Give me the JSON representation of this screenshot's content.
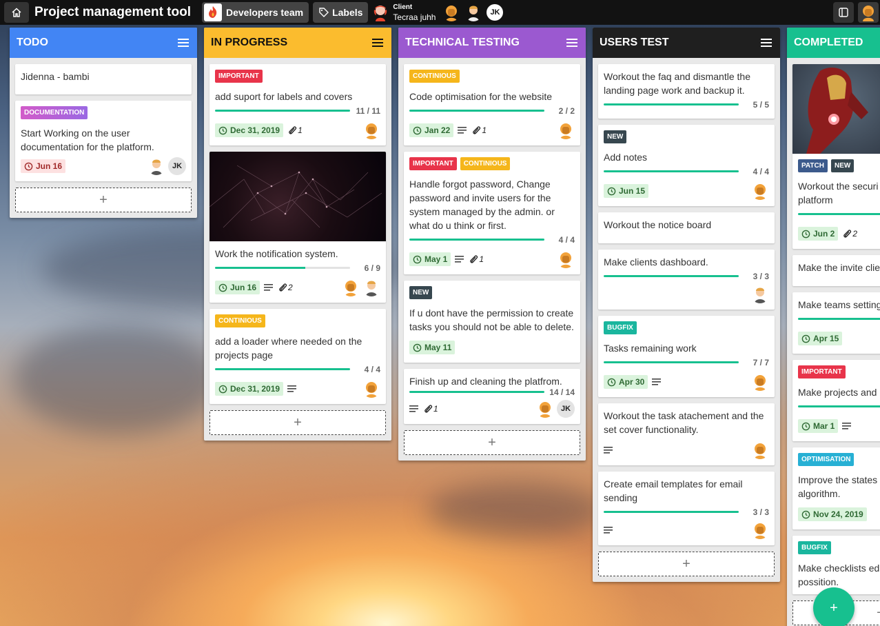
{
  "header": {
    "title": "Project management tool",
    "team": "Developers team",
    "labels": "Labels",
    "client_role": "Client",
    "client_name": "Tecraa juhh",
    "jk": "JK"
  },
  "colors": {
    "todo": "#4285f4",
    "in_progress": "#fbbc2e",
    "testing": "#9b59d0",
    "users_test": "#1f1f1f",
    "completed": "#17c08f",
    "important": "#e8344a",
    "continious": "#f5b61b",
    "documentation": "#c15fd2",
    "new": "#37474f",
    "bugfix": "#1ab69e",
    "patch": "#3c5a8c",
    "optimisation": "#27b0d4"
  },
  "add_label": "+",
  "columns": {
    "todo": {
      "name": "TODO",
      "cards": [
        {
          "title": "Jidenna - bambi"
        },
        {
          "tag": "DOCUMENTATION",
          "title": "Start Working on the user documentation for the platform.",
          "date": "Jun 16",
          "jk": "JK"
        }
      ]
    },
    "in_progress": {
      "name": "IN PROGRESS",
      "cards": [
        {
          "tag": "IMPORTANT",
          "title": "add suport for labels and covers",
          "count": "11 / 11",
          "progress": 1.0,
          "date": "Dec 31, 2019",
          "attachments": "1"
        },
        {
          "title": "Work the notification system.",
          "count": "6 / 9",
          "progress": 0.667,
          "date": "Jun 16",
          "attachments": "2"
        },
        {
          "tag": "CONTINIOUS",
          "title": "add a loader where needed on the projects page",
          "count": "4 / 4",
          "progress": 1.0,
          "date": "Dec 31, 2019"
        }
      ]
    },
    "testing": {
      "name": "TECHNICAL TESTING",
      "cards": [
        {
          "tag": "CONTINIOUS",
          "title": "Code optimisation for the website",
          "count": "2 / 2",
          "progress": 1.0,
          "date": "Jan 22",
          "attachments": "1"
        },
        {
          "tag": "IMPORTANT",
          "tag2": "CONTINIOUS",
          "title": "Handle forgot password, Change password and invite users for the system managed by the admin. or what do u think or first.",
          "count": "4 / 4",
          "progress": 1.0,
          "date": "May 1",
          "attachments": "1"
        },
        {
          "tag": "NEW",
          "title": "If u dont have the permission to create tasks you should not be able to delete.",
          "date": "May 11"
        },
        {
          "title": "Finish up and cleaning the platfrom.",
          "count": "14 / 14",
          "progress": 1.0,
          "attachments": "1",
          "jk": "JK"
        }
      ]
    },
    "users_test": {
      "name": "USERS TEST",
      "cards": [
        {
          "title": "Workout the faq and dismantle the landing page work and backup it.",
          "count": "5 / 5",
          "progress": 1.0
        },
        {
          "tag": "NEW",
          "title": "Add notes",
          "count": "4 / 4",
          "progress": 1.0,
          "date": "Jun 15"
        },
        {
          "title": "Workout the notice board"
        },
        {
          "title": "Make clients dashboard.",
          "count": "3 / 3",
          "progress": 1.0
        },
        {
          "tag": "BUGFIX",
          "title": "Tasks remaining work",
          "count": "7 / 7",
          "progress": 1.0,
          "date": "Apr 30"
        },
        {
          "title": "Workout the task atachement and the set cover functionality."
        },
        {
          "title": "Create email templates for email sending",
          "count": "3 / 3",
          "progress": 1.0
        }
      ]
    },
    "completed": {
      "name": "COMPLETED",
      "cards": [
        {
          "tag": "PATCH",
          "tag2": "NEW",
          "title": "Workout the securi platform",
          "date": "Jun 2",
          "attachments": "2"
        },
        {
          "title": "Make the invite clie"
        },
        {
          "title": "Make teams setting",
          "date": "Apr 15"
        },
        {
          "tag": "IMPORTANT",
          "title": "Make projects and",
          "date": "Mar 1"
        },
        {
          "tag": "OPTIMISATION",
          "title": "Improve the states algorithm.",
          "date": "Nov 24, 2019"
        },
        {
          "tag": "BUGFIX",
          "title": "Make checklists ed possition."
        }
      ]
    }
  }
}
